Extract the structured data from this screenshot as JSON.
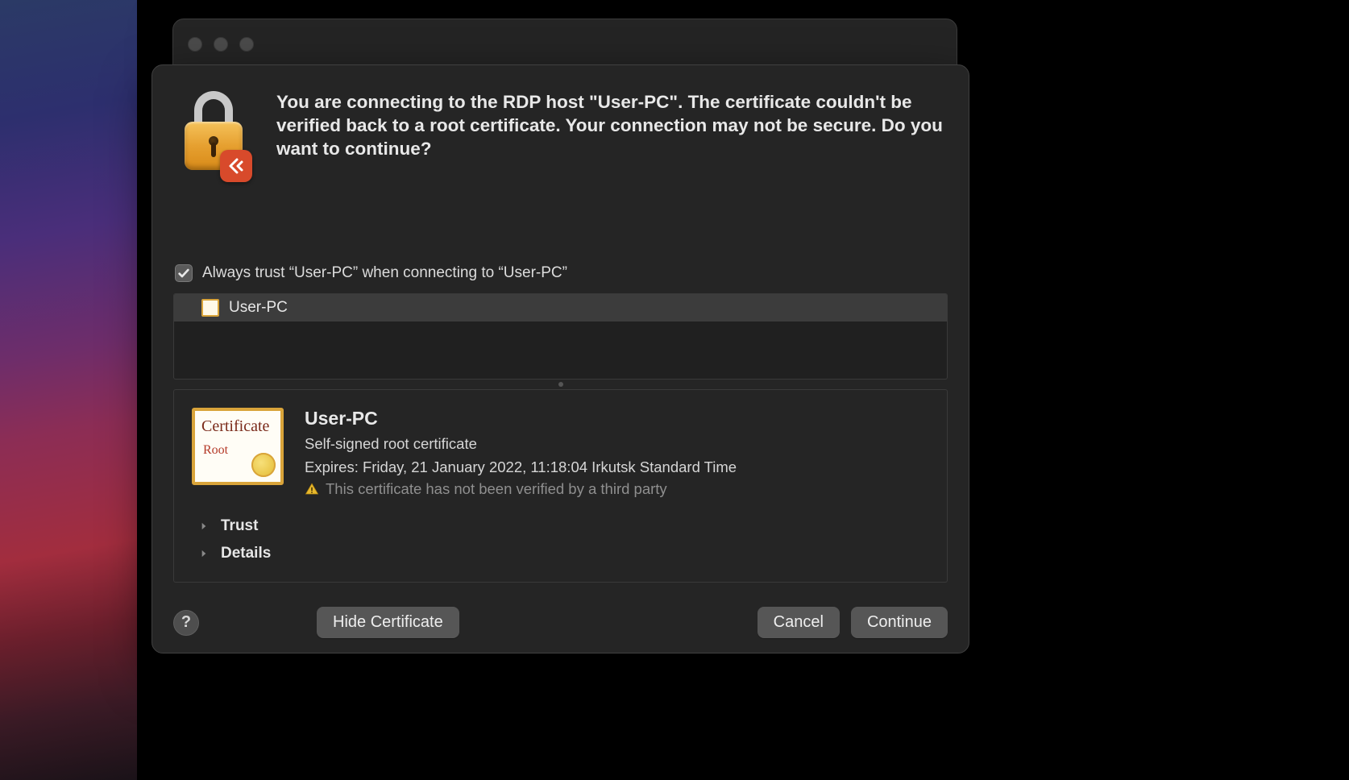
{
  "dialog": {
    "header_message": "You are connecting to the RDP host \"User-PC\". The certificate couldn't be verified back to a root certificate. Your connection may not be secure. Do you want to continue?",
    "always_trust_label": "Always trust “User-PC” when connecting to “User-PC”",
    "always_trust_checked": true,
    "cert_list": {
      "items": [
        {
          "name": "User-PC"
        }
      ]
    },
    "certificate": {
      "name": "User-PC",
      "type_line": "Self-signed root certificate",
      "expires_line": "Expires: Friday, 21 January 2022, 11:18:04 Irkutsk Standard Time",
      "warning_line": "This certificate has not been verified by a third party"
    },
    "disclosures": {
      "trust_label": "Trust",
      "details_label": "Details"
    },
    "buttons": {
      "help_tooltip": "?",
      "hide_certificate": "Hide Certificate",
      "cancel": "Cancel",
      "continue": "Continue"
    }
  }
}
